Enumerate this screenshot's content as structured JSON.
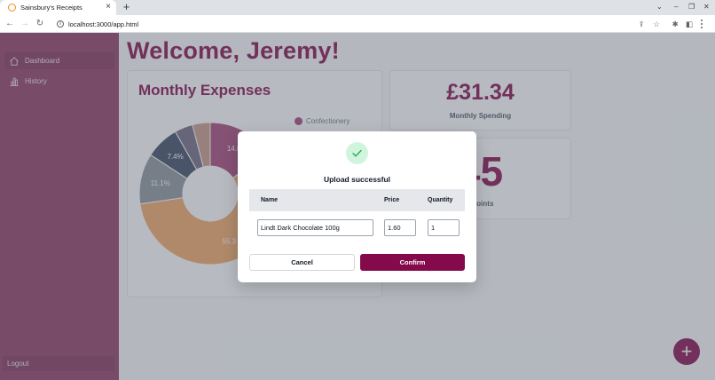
{
  "browser": {
    "tab_title": "Sainsbury's Receipts",
    "tab_close": "×",
    "new_tab": "+",
    "url": "localhost:3000/app.html"
  },
  "sidebar": {
    "items": [
      {
        "label": "Dashboard",
        "icon": "home-icon",
        "active": true
      },
      {
        "label": "History",
        "icon": "bar-chart-icon",
        "active": false
      }
    ],
    "logout_label": "Logout",
    "background": "#8f3a63"
  },
  "main": {
    "welcome": "Welcome, Jeremy!",
    "expenses": {
      "title": "Monthly Expenses",
      "legend": [
        {
          "label": "Confectionery",
          "color": "#a6457a"
        }
      ]
    },
    "spending": {
      "value": "£31.34",
      "label": "Monthly Spending"
    },
    "points": {
      "value_visible": "45",
      "label_visible": "r Points"
    },
    "fab_label": "+"
  },
  "chart_data": {
    "type": "pie",
    "donut": true,
    "slices": [
      {
        "label": "Confectionery",
        "value": 14.8,
        "color": "#a6457a",
        "label_visible": "14.8"
      },
      {
        "value": 55.3,
        "color": "#f2a866",
        "label_visible": "55.3"
      },
      {
        "value": 11.1,
        "color": "#8b949c",
        "label_visible": "11.1%"
      },
      {
        "value": 7.4,
        "color": "#3c4a64",
        "label_visible": "7.4%"
      },
      {
        "value": 4.0,
        "color": "#6f6880"
      },
      {
        "value": 3.9,
        "color": "#c89a86"
      }
    ]
  },
  "modal": {
    "title": "Upload successful",
    "columns": {
      "name": "Name",
      "price": "Price",
      "quantity": "Quantity"
    },
    "row": {
      "name": "Lindt Dark Chocolate 100g",
      "price": "1.60",
      "quantity": "1"
    },
    "cancel_label": "Cancel",
    "confirm_label": "Confirm",
    "accent": "#840a4c",
    "success_color": "#22a055"
  }
}
